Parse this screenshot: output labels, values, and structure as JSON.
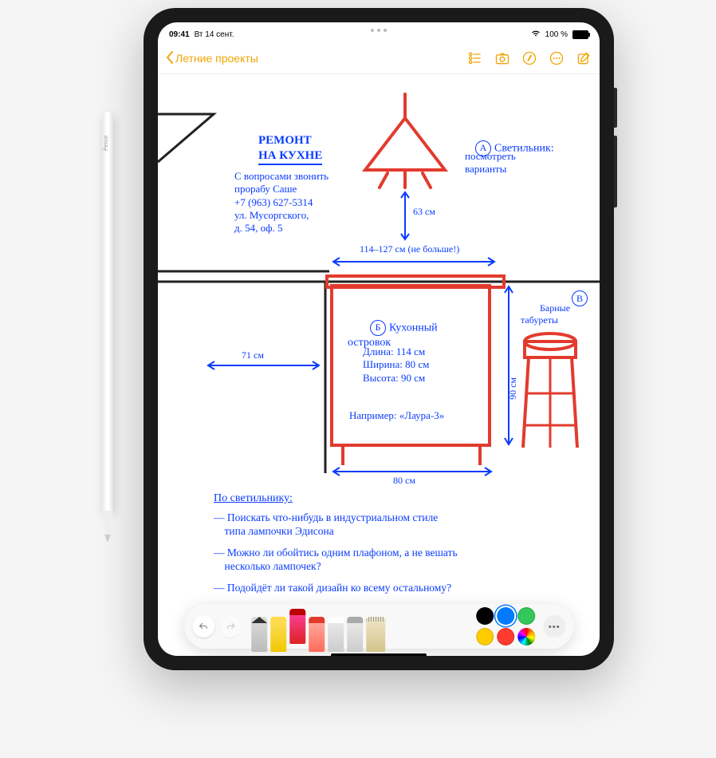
{
  "pencil": {
    "brand": "Pencil"
  },
  "status_bar": {
    "time": "09:41",
    "date": "Вт 14 сент.",
    "battery": "100 %"
  },
  "nav": {
    "back_label": "Летние проекты",
    "icons": {
      "format": "format-options-icon",
      "camera": "camera-icon",
      "markup": "markup-icon",
      "more": "more-icon",
      "compose": "compose-icon"
    }
  },
  "note": {
    "title": "РЕМОНТ\nНА КУХНЕ",
    "contact": "С вопросами звонить\nпрорабу Саше\n+7 (963) 627-5314\nул. Мусоргского,\nд. 54, оф. 5",
    "lamp": {
      "label_letter": "А",
      "label": "Светильник:",
      "note": "посмотреть\nварианты"
    },
    "dimensions": {
      "height_63": "63 см",
      "width_range": "114–127 см (не больше!)",
      "gap_71": "71 см",
      "height_90": "90 см",
      "width_80": "80 см"
    },
    "island": {
      "label_letter": "Б",
      "label": "Кухонный\nостровок",
      "specs": "Длина: 114 см\nШирина: 80 см\nВысота: 90 см",
      "example": "Например: «Лаура-3»"
    },
    "stool": {
      "label": "Барные\nтабуреты",
      "label_letter": "В"
    },
    "checklist_title": "По светильнику:",
    "checklist": [
      "— Поискать что-нибудь в индустриальном стиле\n    типа лампочки Эдисона",
      "— Можно ли обойтись одним плафоном, а не вешать\n    несколько лампочек?",
      "— Подойдёт ли такой дизайн ко всему остальному?"
    ]
  },
  "toolbar": {
    "colors": {
      "black": "#000000",
      "blue": "#007aff",
      "green": "#34c759",
      "yellow": "#ffcc00",
      "red": "#ff3b30"
    }
  }
}
